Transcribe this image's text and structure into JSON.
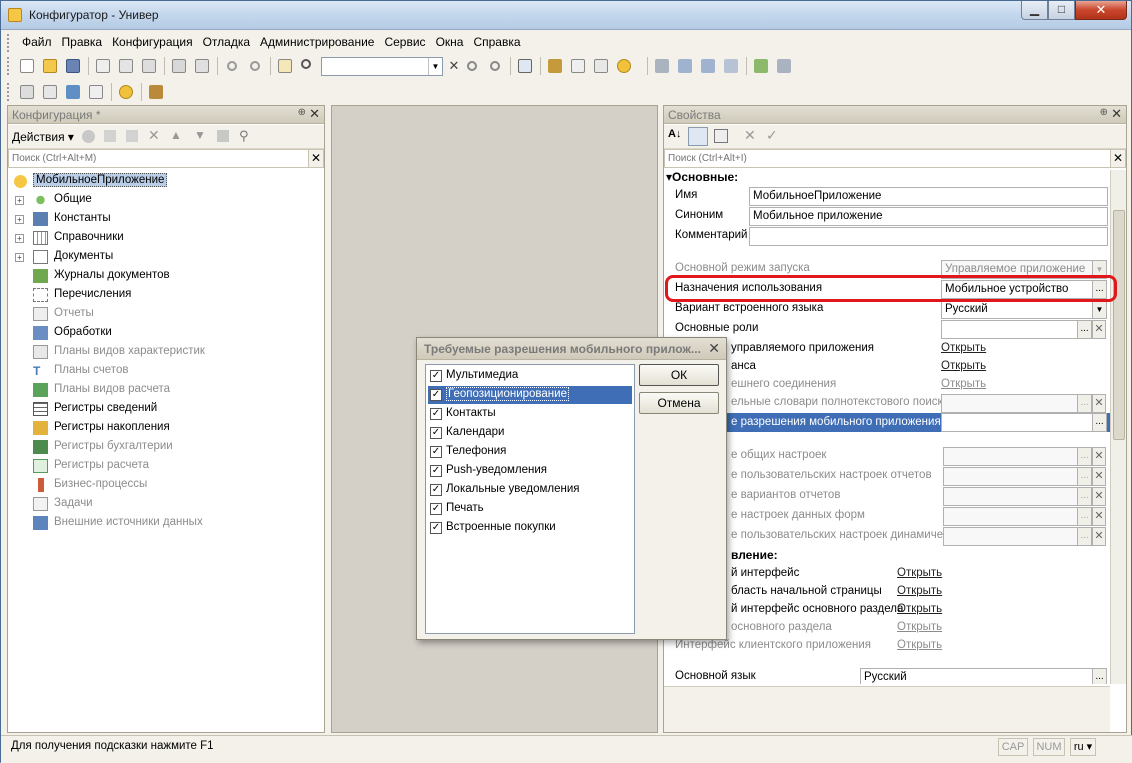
{
  "window": {
    "title": "Конфигуратор - Универ",
    "min_label": "▁",
    "max_label": "□",
    "close_label": "✕"
  },
  "menu": [
    "Файл",
    "Правка",
    "Конфигурация",
    "Отладка",
    "Администрирование",
    "Сервис",
    "Окна",
    "Справка"
  ],
  "left_panel": {
    "title": "Конфигурация *",
    "actions_label": "Действия ▾",
    "search_placeholder": "Поиск (Ctrl+Alt+M)",
    "tree": [
      {
        "label": "МобильноеПриложение",
        "selected": true,
        "expand": "",
        "icon": "app-icon"
      },
      {
        "label": "Общие",
        "expand": "+",
        "icon": "common-icon"
      },
      {
        "label": "Константы",
        "expand": "+",
        "icon": "constants-icon"
      },
      {
        "label": "Справочники",
        "expand": "+",
        "icon": "catalogs-icon"
      },
      {
        "label": "Документы",
        "expand": "+",
        "icon": "documents-icon"
      },
      {
        "label": "Журналы документов",
        "expand": "",
        "icon": "journals-icon"
      },
      {
        "label": "Перечисления",
        "expand": "",
        "icon": "enums-icon"
      },
      {
        "label": "Отчеты",
        "expand": "",
        "icon": "reports-icon",
        "dim": true
      },
      {
        "label": "Обработки",
        "expand": "",
        "icon": "processing-icon"
      },
      {
        "label": "Планы видов характеристик",
        "expand": "",
        "icon": "chart-char-icon",
        "dim": true
      },
      {
        "label": "Планы счетов",
        "expand": "",
        "icon": "chart-accounts-icon",
        "dim": true
      },
      {
        "label": "Планы видов расчета",
        "expand": "",
        "icon": "chart-calc-icon",
        "dim": true
      },
      {
        "label": "Регистры сведений",
        "expand": "",
        "icon": "info-registers-icon"
      },
      {
        "label": "Регистры накопления",
        "expand": "",
        "icon": "accum-registers-icon"
      },
      {
        "label": "Регистры бухгалтерии",
        "expand": "",
        "icon": "acc-registers-icon",
        "dim": true
      },
      {
        "label": "Регистры расчета",
        "expand": "",
        "icon": "calc-registers-icon",
        "dim": true
      },
      {
        "label": "Бизнес-процессы",
        "expand": "",
        "icon": "bp-icon",
        "dim": true
      },
      {
        "label": "Задачи",
        "expand": "",
        "icon": "tasks-icon",
        "dim": true
      },
      {
        "label": "Внешние источники данных",
        "expand": "",
        "icon": "ext-sources-icon",
        "dim": true
      }
    ]
  },
  "right_panel": {
    "title": "Свойства",
    "search_placeholder": "Поиск (Ctrl+Alt+I)",
    "section_main": "Основные:",
    "name_label": "Имя",
    "name_value": "МобильноеПриложение",
    "synonym_label": "Синоним",
    "synonym_value": "Мобильное приложение",
    "comment_label": "Комментарий",
    "comment_value": "",
    "launch_mode_label": "Основной режим запуска",
    "launch_mode_value": "Управляемое приложение",
    "usage_purpose_label": "Назначения использования",
    "usage_purpose_value": "Мобильное устройство",
    "builtin_lang_label": "Вариант встроенного языка",
    "builtin_lang_value": "Русский",
    "main_roles_label": "Основные роли",
    "main_roles_value": "",
    "row_managed_label": "управляемого приложения",
    "row_managed_link": "Открыть",
    "row_balance_label": "анса",
    "row_balance_link": "Открыть",
    "row_ext_label": "ешнего соединения",
    "row_ext_link": "Открыть",
    "row_fulltext_label": "ельные словари полнотекстового поиска",
    "row_mobile_perm_label": "е разрешения мобильного приложения",
    "row_common_label": "е общих настроек",
    "row_user_reports_label": "е пользовательских настроек отчетов",
    "row_report_variants_label": "е вариантов отчетов",
    "row_form_data_label": "е настроек данных форм",
    "row_dynamic_label": "е пользовательских настроек динамическ",
    "section_interface": "вление:",
    "row_iface_label": "й интерфейс",
    "row_iface_link": "Открыть",
    "row_home_label": "бласть начальной страницы",
    "row_home_link": "Открыть",
    "row_main_section_label": "й интерфейс основного раздела",
    "row_main_section_link": "Открыть",
    "row_section_label": "основного раздела",
    "row_section_link": "Открыть",
    "row_client_iface_label": "Интерфейс клиентского приложения",
    "row_client_iface_link": "Открыть",
    "main_lang_label": "Основной язык",
    "main_lang_value": "Русский"
  },
  "dialog": {
    "title": "Требуемые разрешения мобильного прилож...",
    "ok_label": "ОК",
    "cancel_label": "Отмена",
    "items": [
      {
        "label": "Мультимедиа",
        "checked": true
      },
      {
        "label": "Геопозиционирование",
        "checked": true,
        "selected": true
      },
      {
        "label": "Контакты",
        "checked": true
      },
      {
        "label": "Календари",
        "checked": true
      },
      {
        "label": "Телефония",
        "checked": true
      },
      {
        "label": "Push-уведомления",
        "checked": true
      },
      {
        "label": "Локальные уведомления",
        "checked": true
      },
      {
        "label": "Печать",
        "checked": true
      },
      {
        "label": "Встроенные покупки",
        "checked": true
      }
    ]
  },
  "status": {
    "hint": "Для получения подсказки нажмите F1",
    "cap": "CAP",
    "num": "NUM",
    "lang": "ru ▾"
  }
}
